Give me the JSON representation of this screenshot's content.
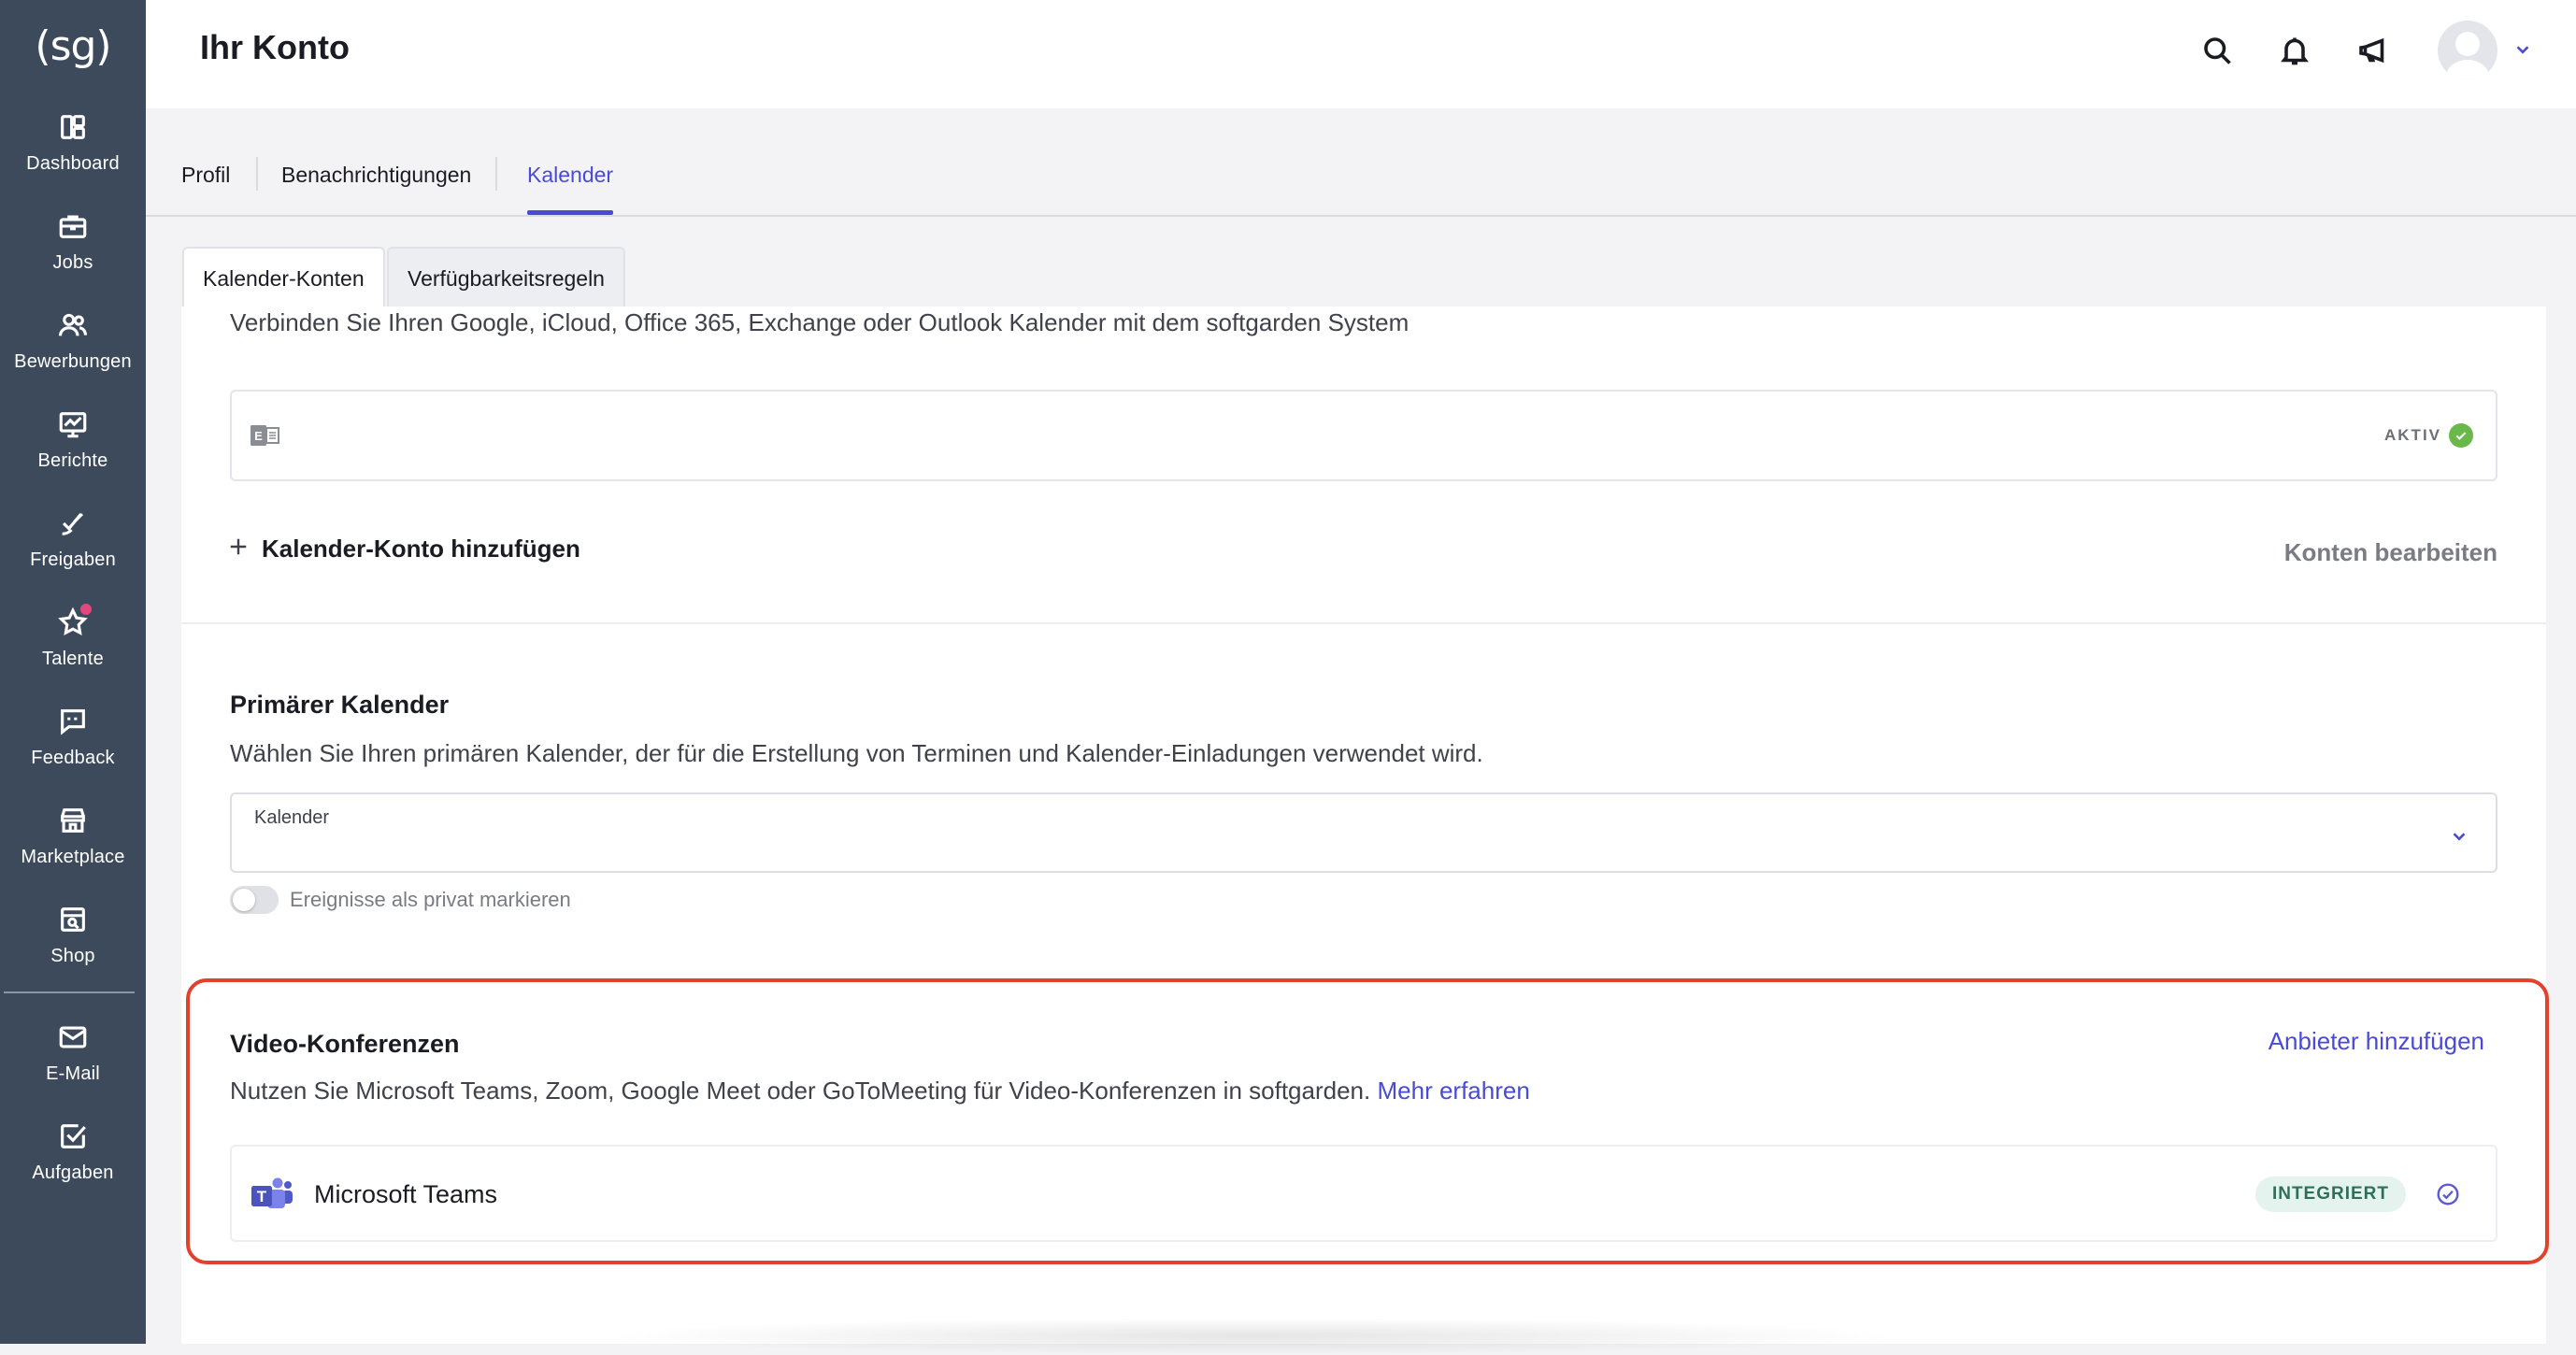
{
  "sidebar": {
    "logo": "(sg)",
    "items": [
      {
        "label": "Dashboard",
        "icon": "dashboard-icon"
      },
      {
        "label": "Jobs",
        "icon": "briefcase-icon"
      },
      {
        "label": "Bewerbungen",
        "icon": "users-icon"
      },
      {
        "label": "Berichte",
        "icon": "chart-icon"
      },
      {
        "label": "Freigaben",
        "icon": "approval-icon"
      },
      {
        "label": "Talente",
        "icon": "star-icon"
      },
      {
        "label": "Feedback",
        "icon": "feedback-icon"
      },
      {
        "label": "Marketplace",
        "icon": "store-icon"
      },
      {
        "label": "Shop",
        "icon": "shop-icon"
      },
      {
        "label": "E-Mail",
        "icon": "mail-icon"
      },
      {
        "label": "Aufgaben",
        "icon": "tasks-icon"
      }
    ]
  },
  "header": {
    "title": "Ihr Konto",
    "icons": [
      "search-icon",
      "bell-icon",
      "megaphone-icon"
    ]
  },
  "tabs": [
    {
      "label": "Profil",
      "active": false
    },
    {
      "label": "Benachrichtigungen",
      "active": false
    },
    {
      "label": "Kalender",
      "active": true
    }
  ],
  "subtabs": [
    {
      "label": "Kalender-Konten",
      "active": true
    },
    {
      "label": "Verfügbarkeitsregeln",
      "active": false
    }
  ],
  "calendar_accounts": {
    "description": "Verbinden Sie Ihren Google, iCloud, Office 365, Exchange oder Outlook Kalender mit dem softgarden System",
    "account_icon": "exchange-icon",
    "account_status": "AKTIV",
    "add_label": "Kalender-Konto hinzufügen",
    "edit_label": "Konten bearbeiten"
  },
  "primary_calendar": {
    "title": "Primärer Kalender",
    "description": "Wählen Sie Ihren primären Kalender, der für die Erstellung von Terminen und Kalender-Einladungen verwendet wird.",
    "select_label": "Kalender",
    "select_value": "",
    "private_toggle_label": "Ereignisse als privat markieren",
    "private_toggle_on": false
  },
  "video_conferences": {
    "title": "Video-Konferenzen",
    "add_provider_label": "Anbieter hinzufügen",
    "description": "Nutzen Sie Microsoft Teams, Zoom, Google Meet oder GoToMeeting für Video-Konferenzen in softgarden.",
    "learn_more_label": "Mehr erfahren",
    "providers": [
      {
        "name": "Microsoft Teams",
        "icon": "teams-icon",
        "status": "INTEGRIERT"
      }
    ]
  },
  "colors": {
    "sidebar": "#3d4a5c",
    "accent": "#4a4ad6",
    "highlight": "#e2412e",
    "active_green": "#6bb84a",
    "integrated_badge_bg": "#e4f3ee",
    "teams": "#5059c9"
  }
}
